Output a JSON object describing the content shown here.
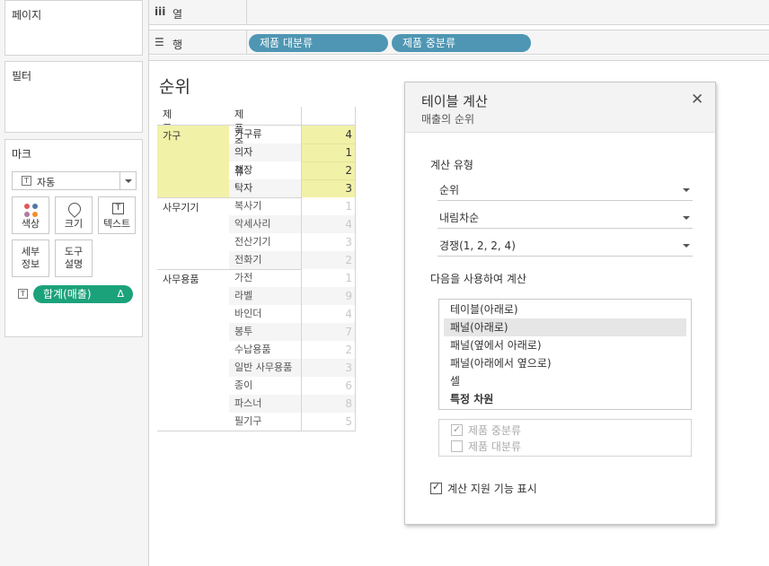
{
  "left_panel": {
    "pages_title": "페이지",
    "filters_title": "필터",
    "marks_title": "마크",
    "mark_type": "자동",
    "mark_buttons": {
      "color": "색상",
      "size": "크기",
      "text": "텍스트",
      "detail_line1": "세부",
      "detail_line2": "정보",
      "tooltip_line1": "도구",
      "tooltip_line2": "설명"
    },
    "measure_pill": "합계(매출)",
    "measure_pill_delta": "Δ"
  },
  "shelves": {
    "columns_label": "열",
    "rows_label": "행",
    "rows_pills": [
      "제품 대분류",
      "제품 중분류"
    ]
  },
  "viz": {
    "title": "순위",
    "headers": [
      "제품 대분류",
      "제품 중분류"
    ],
    "groups": [
      {
        "category": "가구",
        "rows": [
          {
            "sub": "가구류",
            "rank": "4"
          },
          {
            "sub": "의자",
            "rank": "1"
          },
          {
            "sub": "책장",
            "rank": "2"
          },
          {
            "sub": "탁자",
            "rank": "3"
          }
        ]
      },
      {
        "category": "사무기기",
        "rows": [
          {
            "sub": "복사기",
            "rank": "1"
          },
          {
            "sub": "악세사리",
            "rank": "4"
          },
          {
            "sub": "전산기기",
            "rank": "3"
          },
          {
            "sub": "전화기",
            "rank": "2"
          }
        ]
      },
      {
        "category": "사무용품",
        "rows": [
          {
            "sub": "가전",
            "rank": "1"
          },
          {
            "sub": "라벨",
            "rank": "9"
          },
          {
            "sub": "바인더",
            "rank": "4"
          },
          {
            "sub": "봉투",
            "rank": "7"
          },
          {
            "sub": "수납용품",
            "rank": "2"
          },
          {
            "sub": "일반 사무용품",
            "rank": "3"
          },
          {
            "sub": "종이",
            "rank": "6"
          },
          {
            "sub": "파스너",
            "rank": "8"
          },
          {
            "sub": "필기구",
            "rank": "5"
          }
        ]
      }
    ]
  },
  "dialog": {
    "title": "테이블 계산",
    "subtitle": "매출의 순위",
    "close": "✕",
    "calc_type_label": "계산 유형",
    "calc_type_value": "순위",
    "order_value": "내림차순",
    "tie_value": "경쟁(1, 2, 2, 4)",
    "compute_using_label": "다음을 사용하여 계산",
    "compute_options": [
      "테이블(아래로)",
      "패널(아래로)",
      "패널(옆에서 아래로)",
      "패널(아래에서 옆으로)",
      "셀",
      "특정 차원"
    ],
    "selected_option": "패널(아래로)",
    "dimensions": [
      {
        "label": "제품 중분류",
        "checked": true
      },
      {
        "label": "제품 대분류",
        "checked": false
      }
    ],
    "show_assist_label": "계산 지원 기능 표시",
    "show_assist_checked": true
  },
  "colors": {
    "highlight": "#f2f1a8",
    "row_pill": "#4e96b3",
    "measure_pill": "#1ba27a"
  }
}
